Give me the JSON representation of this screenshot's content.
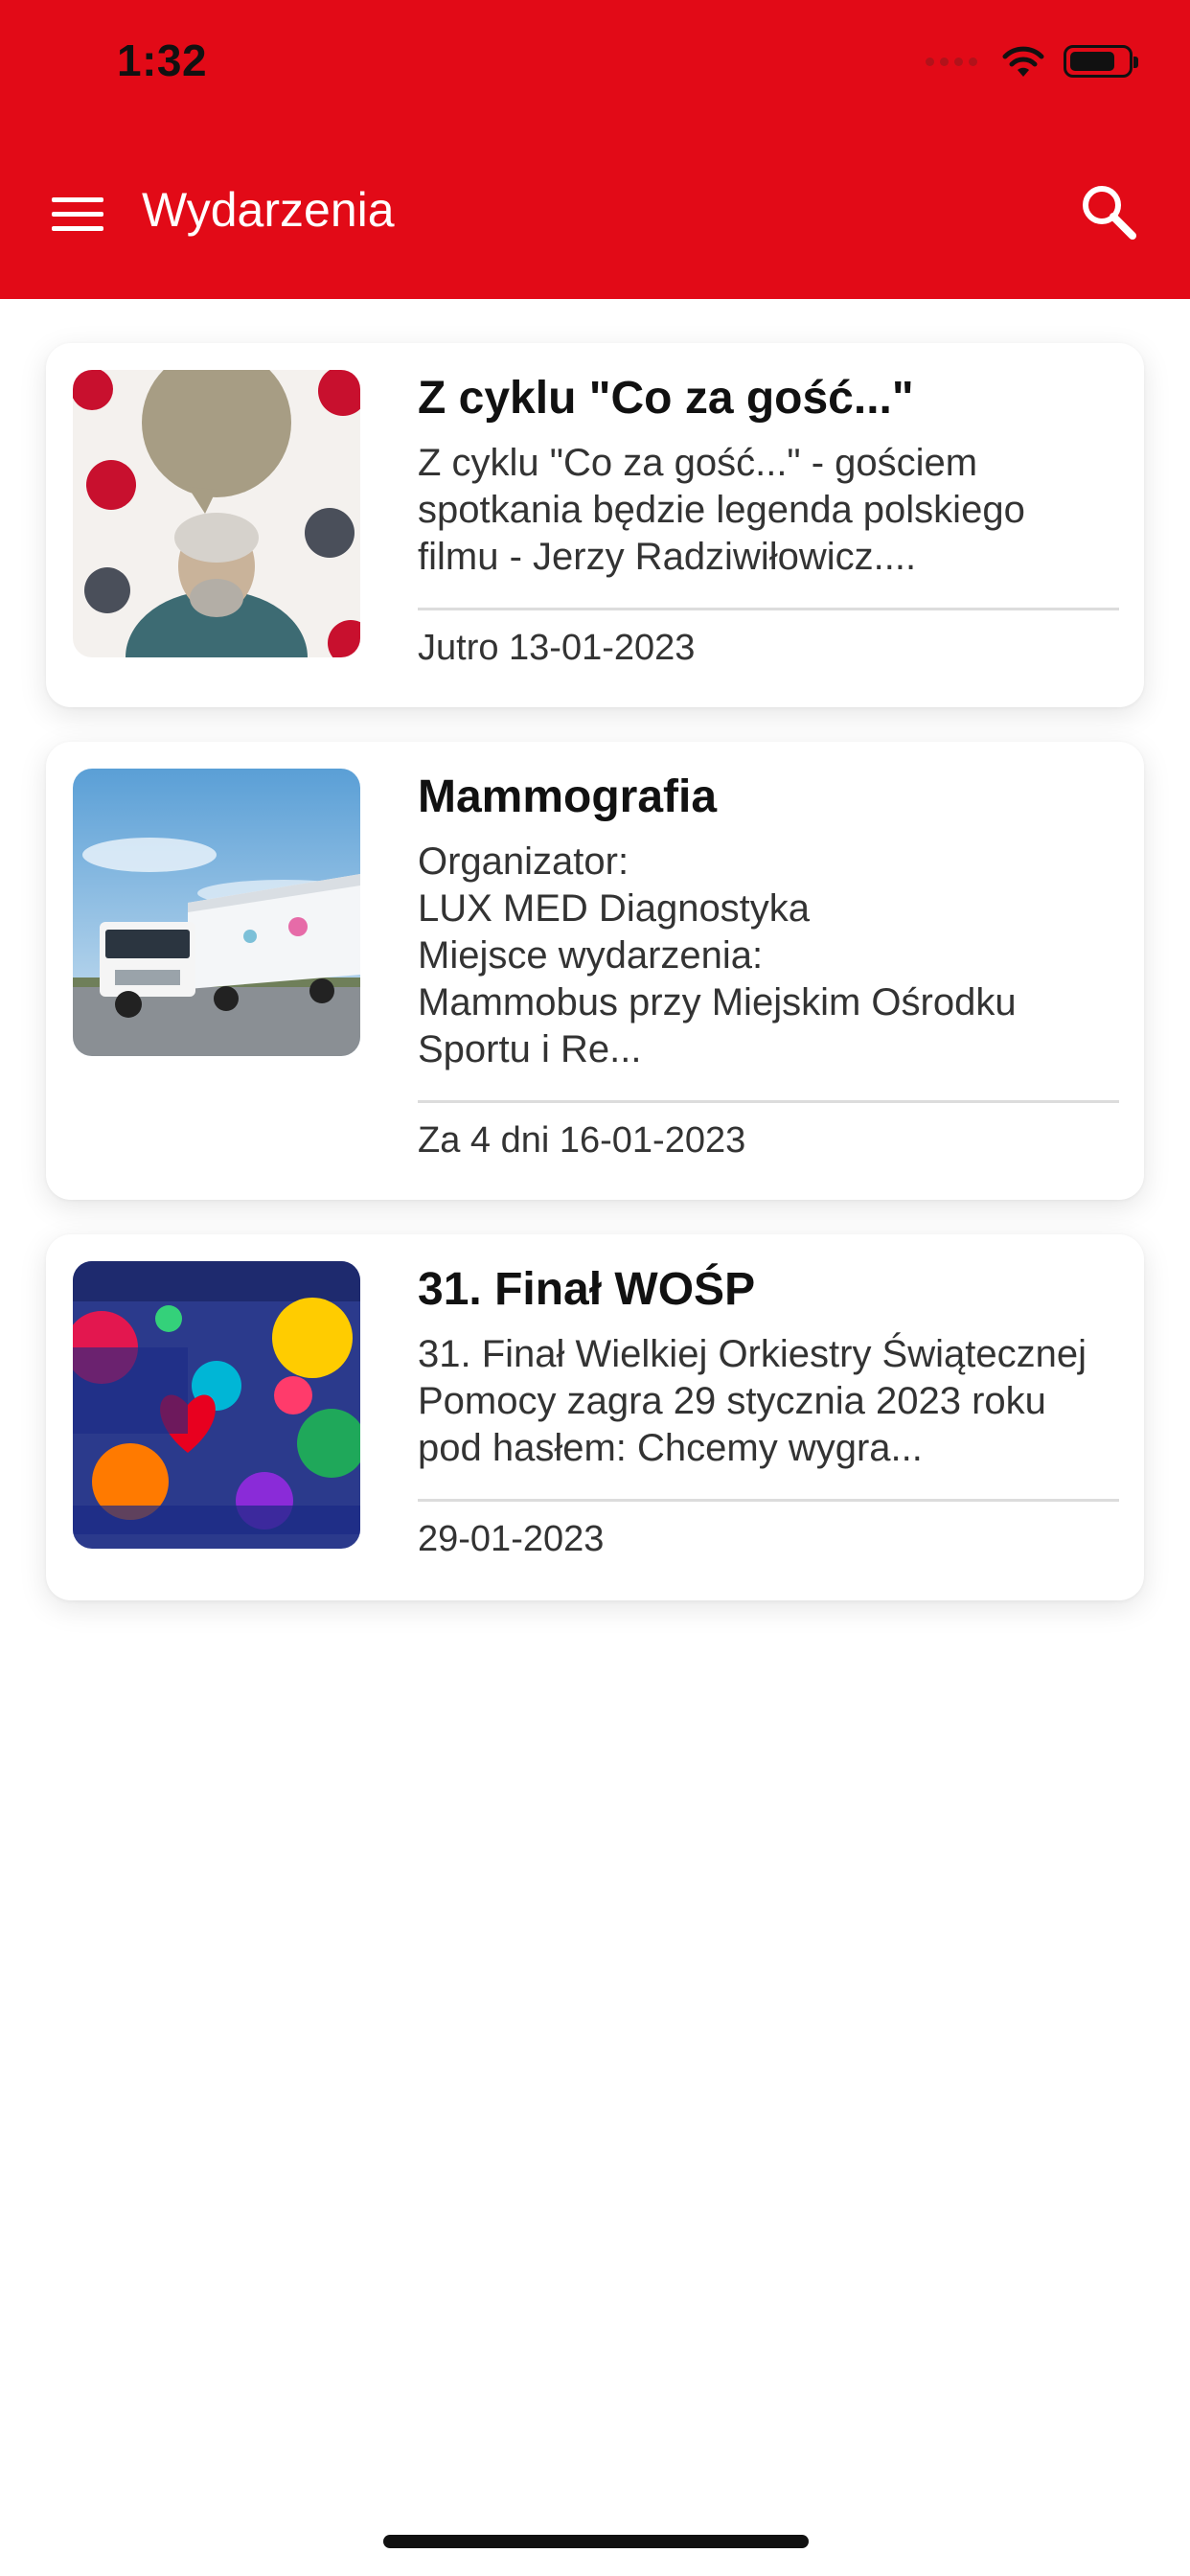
{
  "status_bar": {
    "time": "1:32"
  },
  "header": {
    "title": "Wydarzenia",
    "menu_icon": "hamburger-menu-icon",
    "search_icon": "search-icon",
    "background": "#e20a17"
  },
  "events": [
    {
      "title": "Z cyklu \"Co za gość...\"",
      "description": "Z cyklu \"Co za gość...\" - gościem\nspotkania będzie legenda polskiego\nfilmu - Jerzy Radziwiłowicz....",
      "date": "Jutro 13-01-2023"
    },
    {
      "title": "Mammografia",
      "description": "Organizator:\nLUX MED Diagnostyka\nMiejsce wydarzenia:\nMammobus przy Miejskim Ośrodku\nSportu i Re...",
      "date": "Za 4 dni 16-01-2023"
    },
    {
      "title": "31. Finał WOŚP",
      "description": "31. Finał Wielkiej Orkiestry Świątecznej\nPomocy zagra 29 stycznia 2023 roku\npod hasłem: Chcemy wygra...",
      "date": "29-01-2023"
    }
  ]
}
